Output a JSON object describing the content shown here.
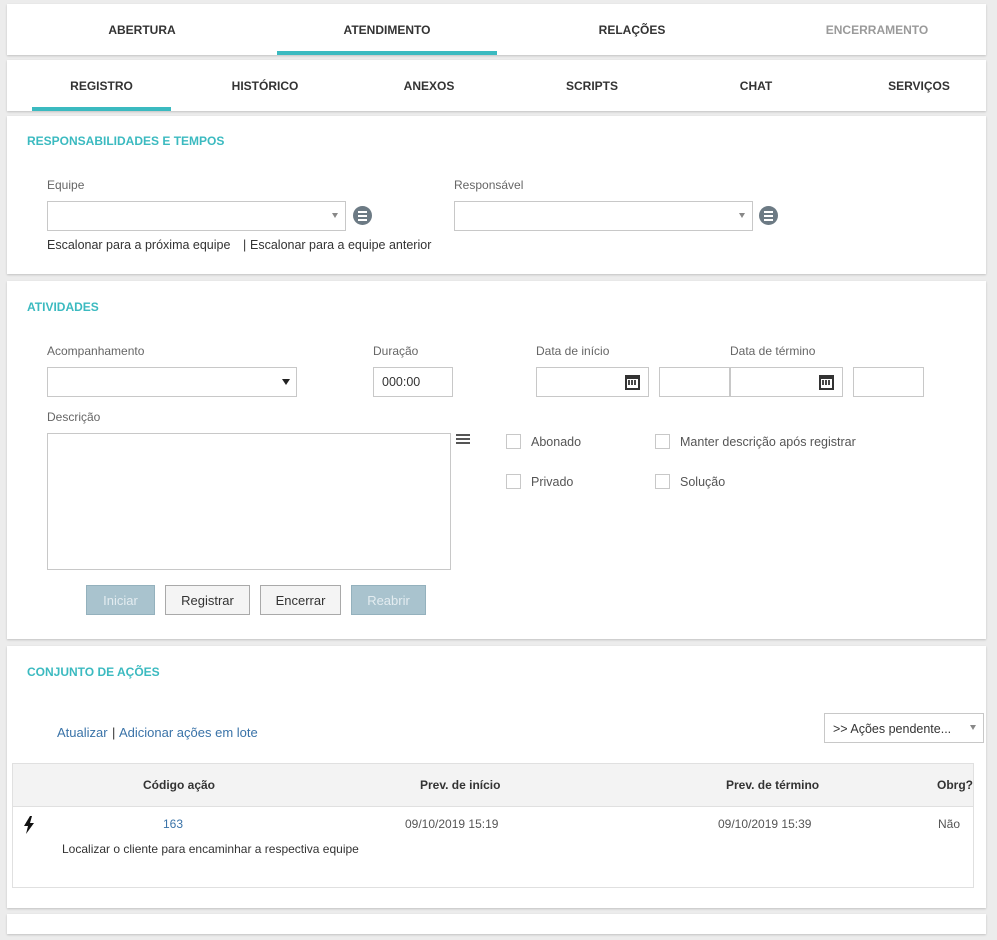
{
  "main_tabs": [
    {
      "label": "ABERTURA"
    },
    {
      "label": "ATENDIMENTO"
    },
    {
      "label": "RELAÇÕES"
    },
    {
      "label": "ENCERRAMENTO"
    }
  ],
  "sub_tabs": [
    {
      "label": "REGISTRO"
    },
    {
      "label": "HISTÓRICO"
    },
    {
      "label": "ANEXOS"
    },
    {
      "label": "SCRIPTS"
    },
    {
      "label": "CHAT"
    },
    {
      "label": "SERVIÇOS"
    }
  ],
  "responsabilidades": {
    "title": "RESPONSABILIDADES E TEMPOS",
    "equipe_label": "Equipe",
    "equipe_value": "",
    "responsavel_label": "Responsável",
    "responsavel_value": "",
    "escalonar_proxima": "Escalonar para a próxima equipe",
    "separator": "|",
    "escalonar_anterior": "Escalonar para a equipe anterior"
  },
  "atividades": {
    "title": "ATIVIDADES",
    "acompanhamento_label": "Acompanhamento",
    "acompanhamento_value": "",
    "duracao_label": "Duração",
    "duracao_value": "000:00",
    "data_inicio_label": "Data de início",
    "data_inicio_value": "",
    "hora_inicio_value": "",
    "data_termino_label": "Data de término",
    "data_termino_value": "",
    "hora_termino_value": "",
    "descricao_label": "Descrição",
    "descricao_value": "",
    "checkboxes": {
      "abonado": "Abonado",
      "manter": "Manter descrição após registrar",
      "privado": "Privado",
      "solucao": "Solução"
    },
    "buttons": {
      "iniciar": "Iniciar",
      "registrar": "Registrar",
      "encerrar": "Encerrar",
      "reabrir": "Reabrir"
    }
  },
  "conjunto": {
    "title": "CONJUNTO DE AÇÕES",
    "atualizar": "Atualizar",
    "separator": "|",
    "adicionar": "Adicionar ações em lote",
    "filter_value": ">> Ações pendente...",
    "columns": {
      "codigo": "Código ação",
      "prev_inicio": "Prev. de início",
      "prev_termino": "Prev. de término",
      "obrg": "Obrg?"
    },
    "rows": [
      {
        "icon": "bolt-icon",
        "codigo": "163",
        "prev_inicio": "09/10/2019 15:19",
        "prev_termino": "09/10/2019 15:39",
        "obrg": "Não",
        "descricao": "Localizar o cliente para encaminhar a respectiva equipe"
      }
    ]
  },
  "colors": {
    "accent": "#3bbac0",
    "link": "#3a73a8",
    "disabled_button": "#a9c3ce"
  }
}
